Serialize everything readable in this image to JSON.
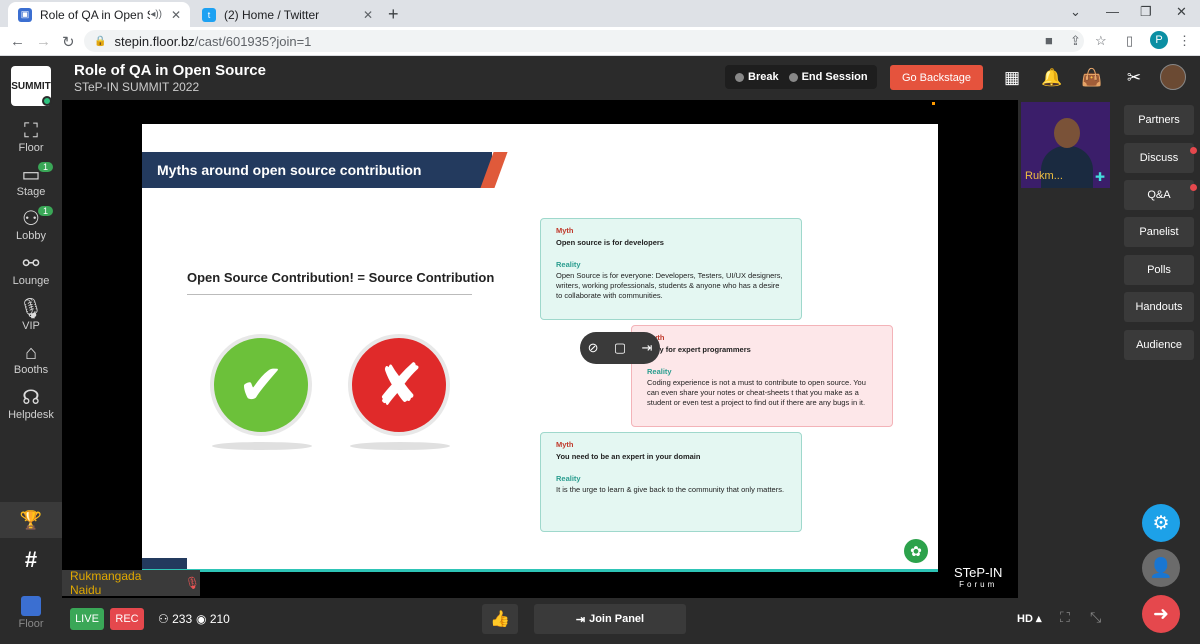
{
  "browser": {
    "tabs": [
      {
        "title": "Role of QA in Open Source",
        "active": true
      },
      {
        "title": "(2) Home / Twitter",
        "active": false
      }
    ],
    "url_host": "stepin.floor.bz",
    "url_path": "/cast/601935?join=1",
    "profile_initial": "P"
  },
  "sidebar": {
    "logo_text": "SUMMIT",
    "items": [
      {
        "label": "Floor",
        "icon": "map-icon"
      },
      {
        "label": "Stage",
        "icon": "video-icon",
        "badge": "1"
      },
      {
        "label": "Lobby",
        "icon": "people-icon",
        "badge": "1"
      },
      {
        "label": "Lounge",
        "icon": "handshake-icon"
      },
      {
        "label": "VIP",
        "icon": "mic-icon"
      },
      {
        "label": "Booths",
        "icon": "booth-icon"
      },
      {
        "label": "Helpdesk",
        "icon": "headset-icon"
      }
    ],
    "bottom_label": "Floor"
  },
  "header": {
    "title": "Role of QA in Open Source",
    "subtitle": "STeP-IN SUMMIT 2022",
    "break_label": "Break",
    "end_session_label": "End Session",
    "backstage_label": "Go Backstage"
  },
  "slide": {
    "banner": "Myths around open source contribution",
    "equation": "Open Source Contribution! = Source Contribution",
    "cards": [
      {
        "myth_label": "Myth",
        "myth": "Open source is for developers",
        "reality_label": "Reality",
        "reality": "Open Source is for everyone: Developers, Testers, UI/UX designers, writers, working professionals, students & anyone who has a desire to collaborate with communities."
      },
      {
        "myth_label": "Myth",
        "myth": "Only for expert programmers",
        "reality_label": "Reality",
        "reality": "Coding experience is not a must to contribute to open source. You can even share your notes or cheat-sheets t that you make as a student or even test a project to find out if there are any bugs in it."
      },
      {
        "myth_label": "Myth",
        "myth": "You need to be an expert in your domain",
        "reality_label": "Reality",
        "reality": "It is the urge to learn & give back to the community that only matters."
      }
    ]
  },
  "forum": {
    "brand": "STeP-IN",
    "sub": "Forum"
  },
  "speaker": {
    "name": "Rukmangada Naidu",
    "tile_name": "Rukm..."
  },
  "right_panel": {
    "items": [
      {
        "label": "Partners",
        "dot": false
      },
      {
        "label": "Discuss",
        "dot": true
      },
      {
        "label": "Q&A",
        "dot": true
      },
      {
        "label": "Panelist",
        "dot": false
      },
      {
        "label": "Polls",
        "dot": false
      },
      {
        "label": "Handouts",
        "dot": false
      },
      {
        "label": "Audience",
        "dot": false
      }
    ]
  },
  "footer": {
    "live_label": "LIVE",
    "rec_label": "REC",
    "attendees": "233",
    "viewers": "210",
    "join_panel_label": "Join Panel",
    "quality": "HD"
  },
  "colors": {
    "live": "#3aa757",
    "rec": "#e5484d",
    "backstage": "#e5533d",
    "settings_fab": "#1da1e8",
    "add_user_fab": "#6b6b6b",
    "exit_fab": "#e5484d"
  }
}
